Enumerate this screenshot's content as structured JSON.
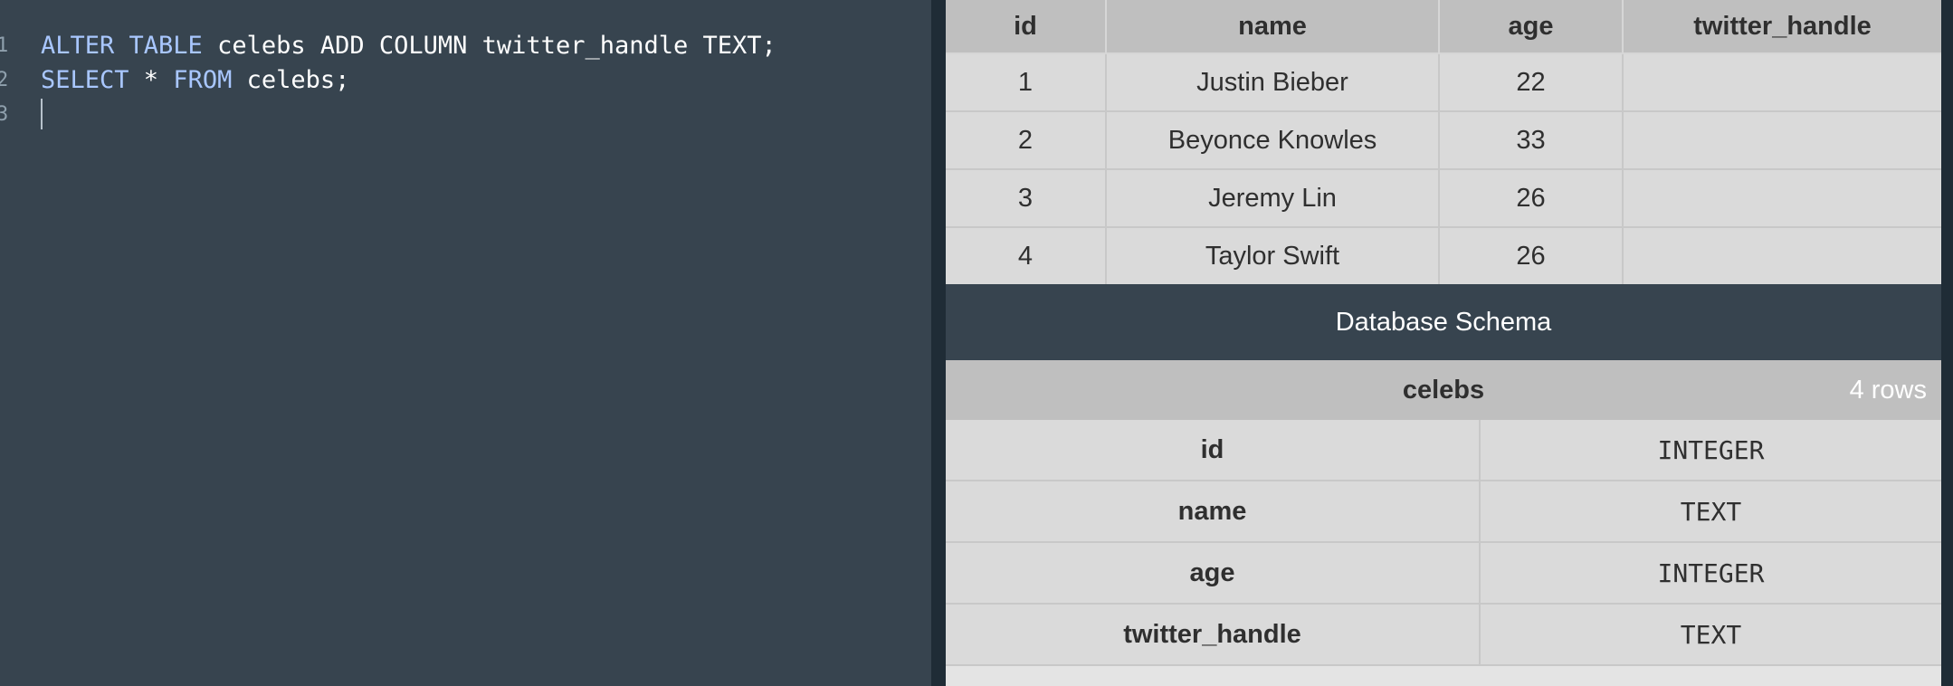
{
  "editor": {
    "lines": [
      {
        "num": "1",
        "tokens": [
          {
            "text": "ALTER TABLE",
            "kw": true
          },
          {
            "text": " celebs ADD COLUMN twitter_handle TEXT;",
            "kw": false
          }
        ]
      },
      {
        "num": "2",
        "tokens": [
          {
            "text": "SELECT",
            "kw": true
          },
          {
            "text": " * ",
            "kw": false
          },
          {
            "text": "FROM",
            "kw": true
          },
          {
            "text": " celebs;",
            "kw": false
          }
        ]
      },
      {
        "num": "3",
        "tokens": []
      }
    ]
  },
  "results": {
    "columns": [
      "id",
      "name",
      "age",
      "twitter_handle"
    ],
    "rows": [
      [
        "1",
        "Justin Bieber",
        "22",
        ""
      ],
      [
        "2",
        "Beyonce Knowles",
        "33",
        ""
      ],
      [
        "3",
        "Jeremy Lin",
        "26",
        ""
      ],
      [
        "4",
        "Taylor Swift",
        "26",
        ""
      ]
    ]
  },
  "schema": {
    "title": "Database Schema",
    "table_name": "celebs",
    "row_count": "4 rows",
    "fields": [
      {
        "name": "id",
        "type": "INTEGER"
      },
      {
        "name": "name",
        "type": "TEXT"
      },
      {
        "name": "age",
        "type": "INTEGER"
      },
      {
        "name": "twitter_handle",
        "type": "TEXT"
      }
    ]
  },
  "colors": {
    "editor_bg": "#37444f",
    "keyword": "#a9c7ff",
    "divider": "#1f2c36",
    "table_header_bg": "#bfbfbf",
    "table_cell_bg": "#dadada"
  }
}
